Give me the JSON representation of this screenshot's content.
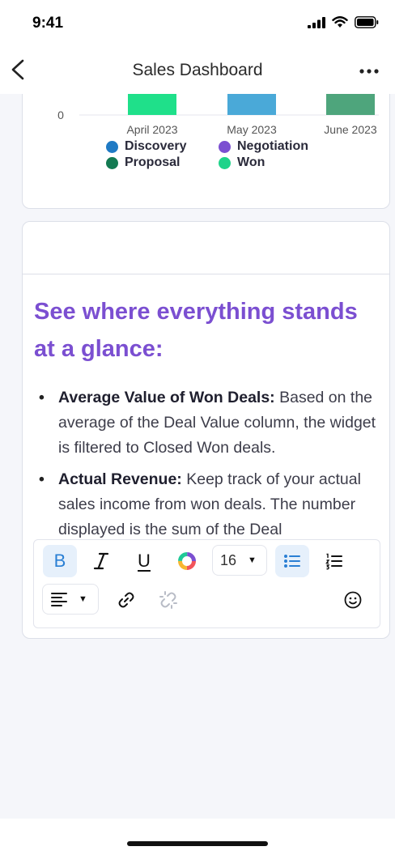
{
  "status_bar": {
    "time": "9:41"
  },
  "nav": {
    "title": "Sales Dashboard"
  },
  "chart": {
    "y_tick": "0",
    "legend": [
      {
        "name": "Discovery",
        "color": "#1f7ac4"
      },
      {
        "name": "Negotiation",
        "color": "#7b4fd1"
      },
      {
        "name": "Proposal",
        "color": "#137a52"
      },
      {
        "name": "Won",
        "color": "#1fd38a"
      }
    ]
  },
  "chart_data": {
    "type": "bar",
    "categories": [
      "April 2023",
      "May 2023",
      "June 2023"
    ],
    "series": [
      {
        "name": "Won",
        "color": "#1fe08a",
        "values": [
          1,
          0,
          0
        ]
      },
      {
        "name": "Discovery",
        "color": "#4aa9d8",
        "values": [
          0,
          1,
          0
        ]
      },
      {
        "name": "Proposal",
        "color": "#4ea57c",
        "values": [
          0,
          0,
          1
        ]
      }
    ],
    "y_tick_labels": [
      "0"
    ],
    "legend_position": "bottom"
  },
  "editor": {
    "heading": "See where everything stands at a glance:",
    "items": [
      {
        "bullet": "•",
        "title": "Average Value of Won Deals:",
        "text": " Based on the average of the Deal Value column, the widget is filtered to Closed Won deals."
      },
      {
        "bullet": "•",
        "title": "Actual Revenue:",
        "text": " Keep track of your actual sales income from won deals. The number displayed is the sum of the Deal"
      }
    ]
  },
  "toolbar": {
    "bold": "B",
    "italic": "I",
    "underline": "U",
    "font_size": "16",
    "icons": [
      "bold-icon",
      "italic-icon",
      "underline-icon",
      "color-wheel-icon",
      "bullet-list-icon",
      "numbered-list-icon",
      "align-left-icon",
      "link-icon",
      "unlink-icon",
      "emoji-icon"
    ]
  }
}
